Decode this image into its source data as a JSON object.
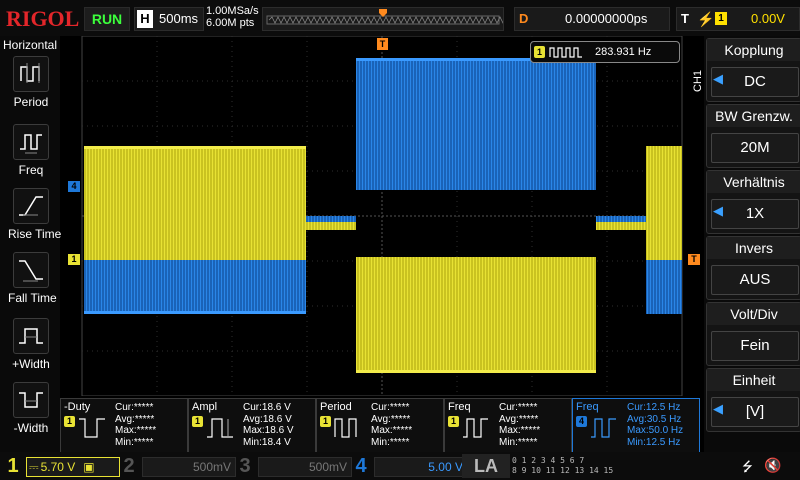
{
  "colors": {
    "ch1": "#e8e234",
    "ch4": "#1e78d8",
    "trigger": "#ff8a1e",
    "run": "#3cff3c",
    "brand": "#e3262a"
  },
  "top": {
    "brand": "RIGOL",
    "run_state": "RUN",
    "timebase_label": "H",
    "timebase": "500ms",
    "sample_rate": "1.00MSa/s",
    "mem_depth": "6.00M pts",
    "delay_label": "D",
    "delay": "0.00000000ps",
    "trigger_label": "T",
    "trigger_source": "1",
    "trigger_level": "0.00V"
  },
  "left": {
    "title": "Horizontal",
    "items": [
      {
        "label": "Period",
        "icon": "period-icon"
      },
      {
        "label": "Freq",
        "icon": "frequency-icon"
      },
      {
        "label": "Rise Time",
        "icon": "rise-time-icon"
      },
      {
        "label": "Fall Time",
        "icon": "fall-time-icon"
      },
      {
        "label": "+Width",
        "icon": "positive-width-icon"
      },
      {
        "label": "-Width",
        "icon": "negative-width-icon"
      }
    ]
  },
  "screen": {
    "counter_channel": "1",
    "counter_value": "283.931 Hz",
    "ch1_marker": "1",
    "ch4_marker": "4",
    "trigger_marker": "T"
  },
  "right": {
    "channel_tag": "CH1",
    "menu": [
      {
        "title": "Kopplung",
        "value": "DC",
        "arrow": true
      },
      {
        "title": "BW Grenzw.",
        "value": "20M",
        "arrow": false
      },
      {
        "title": "Verhältnis",
        "value": "1X",
        "arrow": true
      },
      {
        "title": "Invers",
        "value": "AUS",
        "arrow": false
      },
      {
        "title": "Volt/Div",
        "value": "Fein",
        "arrow": false
      },
      {
        "title": "Einheit",
        "value": "[V]",
        "arrow": true
      }
    ]
  },
  "measurements": [
    {
      "name": "-Duty",
      "channel": "1",
      "cur": "Cur:*****",
      "avg": "Avg:*****",
      "max": "Max:*****",
      "min": "Min:*****"
    },
    {
      "name": "Ampl",
      "channel": "1",
      "cur": "Cur:18.6 V",
      "avg": "Avg:18.6 V",
      "max": "Max:18.6 V",
      "min": "Min:18.4 V"
    },
    {
      "name": "Period",
      "channel": "1",
      "cur": "Cur:*****",
      "avg": "Avg:*****",
      "max": "Max:*****",
      "min": "Min:*****"
    },
    {
      "name": "Freq",
      "channel": "1",
      "cur": "Cur:*****",
      "avg": "Avg:*****",
      "max": "Max:*****",
      "min": "Min:*****"
    },
    {
      "name": "Freq",
      "channel": "4",
      "cur": "Cur:12.5 Hz",
      "avg": "Avg:30.5 Hz",
      "max": "Max:50.0 Hz",
      "min": "Min:12.5 Hz"
    }
  ],
  "bottom": {
    "channels": [
      {
        "num": "1",
        "scale": "5.70 V"
      },
      {
        "num": "2",
        "scale": "500mV"
      },
      {
        "num": "3",
        "scale": "500mV"
      },
      {
        "num": "4",
        "scale": "5.00 V"
      }
    ],
    "la_label": "LA",
    "la_row1": "0 1 2 3 4 5 6 7",
    "la_row2": "8 9 10 11 12 13 14 15"
  }
}
